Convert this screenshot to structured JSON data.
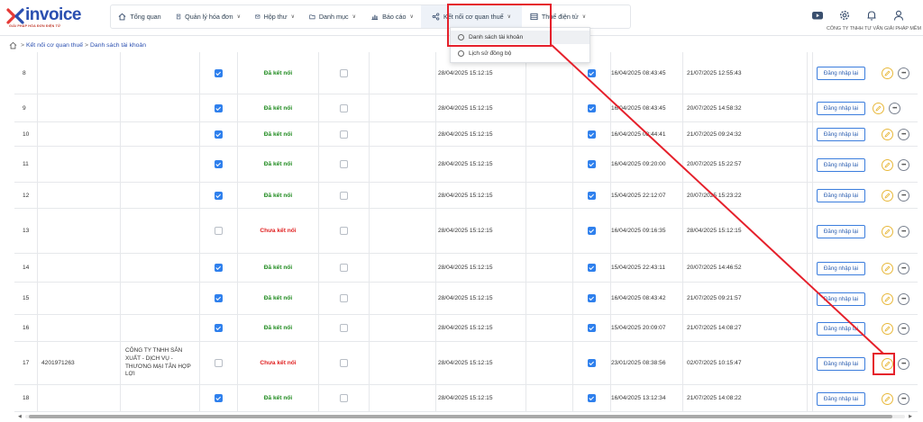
{
  "brand": {
    "name": "invoice",
    "tagline": "GIẢI PHÁP HÓA ĐƠN ĐIỆN TỬ"
  },
  "nav": [
    {
      "label": "Tổng quan",
      "icon": "home-icon",
      "chevron": false
    },
    {
      "label": "Quản lý hóa đơn",
      "icon": "document-icon",
      "chevron": true
    },
    {
      "label": "Hộp thư",
      "icon": "mail-icon",
      "chevron": true
    },
    {
      "label": "Danh mục",
      "icon": "folder-icon",
      "chevron": true
    },
    {
      "label": "Báo cáo",
      "icon": "chart-icon",
      "chevron": true
    },
    {
      "label": "Kết nối cơ quan thuế",
      "icon": "share-icon",
      "chevron": true
    },
    {
      "label": "Thuế điện tử",
      "icon": "list-icon",
      "chevron": true
    }
  ],
  "header_right": {
    "company": "CÔNG TY TNHH TƯ VẤN GIẢI PHÁP MỀM",
    "icons": [
      "youtube-icon",
      "gear-icon",
      "bell-icon",
      "user-icon"
    ]
  },
  "breadcrumb": {
    "items": [
      "Kết nối cơ quan thuế",
      "Danh sách tài khoản"
    ]
  },
  "dropdown": {
    "items": [
      "Danh sách tài khoản",
      "Lịch sử đồng bộ"
    ],
    "selected": 0
  },
  "actions": {
    "login_label": "Đăng nhập lại"
  },
  "status_labels": {
    "ok": "Đã kết nối",
    "no": "Chưa kết nối"
  },
  "colors": {
    "brand": "#2a4fb0",
    "ok": "#1e8a1e",
    "no": "#e02020",
    "checkbox": "#2f80ed",
    "annotation": "#e5202b"
  },
  "rows": [
    {
      "stt": "8",
      "mst": "",
      "name": "",
      "chk1": true,
      "status": "ok",
      "chk2": false,
      "date1": "28/04/2025 15:12:15",
      "chk3": true,
      "date2": "16/04/2025 08:43:45",
      "date3": "21/07/2025 12:55:43"
    },
    {
      "stt": "9",
      "mst": "",
      "name": "",
      "chk1": true,
      "status": "ok",
      "chk2": false,
      "date1": "28/04/2025 15:12:15",
      "chk3": true,
      "date2": "16/04/2025 08:43:45",
      "date3": "20/07/2025 14:58:32"
    },
    {
      "stt": "10",
      "mst": "",
      "name": "",
      "chk1": true,
      "status": "ok",
      "chk2": false,
      "date1": "28/04/2025 15:12:15",
      "chk3": true,
      "date2": "16/04/2025 08:44:41",
      "date3": "21/07/2025 09:24:32"
    },
    {
      "stt": "11",
      "mst": "",
      "name": "",
      "chk1": true,
      "status": "ok",
      "chk2": false,
      "date1": "28/04/2025 15:12:15",
      "chk3": true,
      "date2": "16/04/2025 09:20:00",
      "date3": "20/07/2025 15:22:57"
    },
    {
      "stt": "12",
      "mst": "",
      "name": "",
      "chk1": true,
      "status": "ok",
      "chk2": false,
      "date1": "28/04/2025 15:12:15",
      "chk3": true,
      "date2": "15/04/2025 22:12:07",
      "date3": "20/07/2025 15:23:22"
    },
    {
      "stt": "13",
      "mst": "",
      "name": "",
      "chk1": false,
      "status": "no",
      "chk2": false,
      "date1": "28/04/2025 15:12:15",
      "chk3": true,
      "date2": "16/04/2025 09:16:35",
      "date3": "28/04/2025 15:12:15"
    },
    {
      "stt": "14",
      "mst": "",
      "name": "",
      "chk1": true,
      "status": "ok",
      "chk2": false,
      "date1": "28/04/2025 15:12:15",
      "chk3": true,
      "date2": "15/04/2025 22:43:11",
      "date3": "20/07/2025 14:46:52"
    },
    {
      "stt": "15",
      "mst": "",
      "name": "",
      "chk1": true,
      "status": "ok",
      "chk2": false,
      "date1": "28/04/2025 15:12:15",
      "chk3": true,
      "date2": "16/04/2025 08:43:42",
      "date3": "21/07/2025 09:21:57"
    },
    {
      "stt": "16",
      "mst": "",
      "name": "",
      "chk1": true,
      "status": "ok",
      "chk2": false,
      "date1": "28/04/2025 15:12:15",
      "chk3": true,
      "date2": "15/04/2025 20:09:07",
      "date3": "21/07/2025 14:08:27"
    },
    {
      "stt": "17",
      "mst": "4201971263",
      "name": "CÔNG TY TNHH SẢN XUẤT - DỊCH VỤ - THƯƠNG MẠI TÂN HỢP LỢI",
      "chk1": false,
      "status": "no",
      "chk2": false,
      "date1": "28/04/2025 15:12:15",
      "chk3": true,
      "date2": "23/01/2025 08:38:56",
      "date3": "02/07/2025 10:15:47"
    },
    {
      "stt": "18",
      "mst": "",
      "name": "",
      "chk1": true,
      "status": "ok",
      "chk2": false,
      "date1": "28/04/2025 15:12:15",
      "chk3": true,
      "date2": "16/04/2025 13:12:34",
      "date3": "21/07/2025 14:08:22"
    }
  ]
}
